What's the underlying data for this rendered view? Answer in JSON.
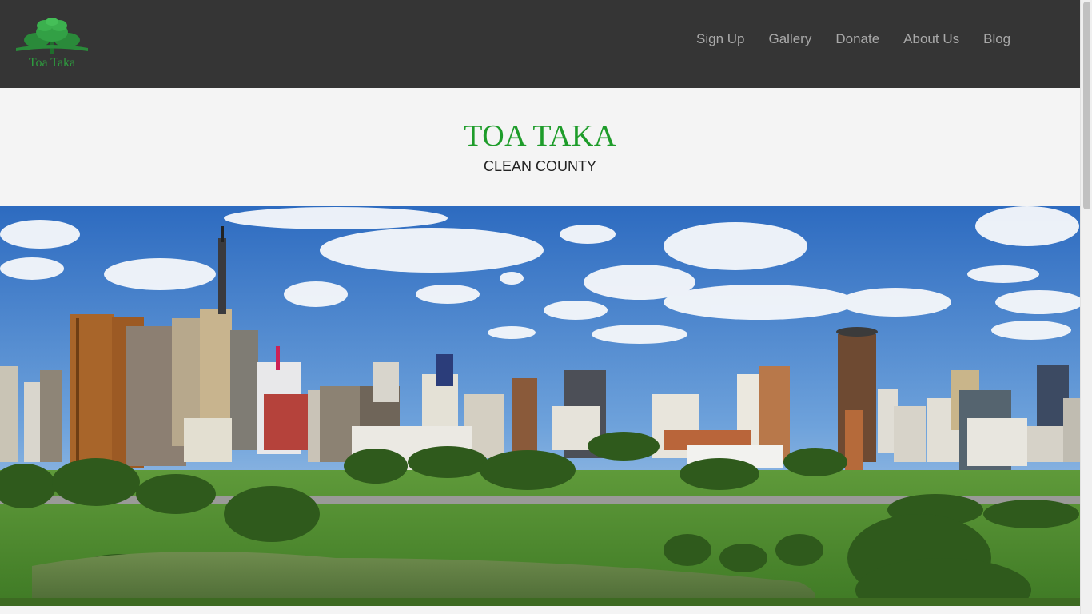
{
  "logo": {
    "text": "Toa Taka",
    "icon": "tree-icon"
  },
  "nav": {
    "items": [
      {
        "label": "Sign Up"
      },
      {
        "label": "Gallery"
      },
      {
        "label": "Donate"
      },
      {
        "label": "About Us"
      },
      {
        "label": "Blog"
      }
    ]
  },
  "hero": {
    "title": "TOA TAKA",
    "tagline": "CLEAN COUNTY",
    "image": "city-skyline-park"
  },
  "colors": {
    "navbar_bg": "#353535",
    "title_green": "#1e9c2a",
    "nav_text": "#a9a9a9"
  }
}
